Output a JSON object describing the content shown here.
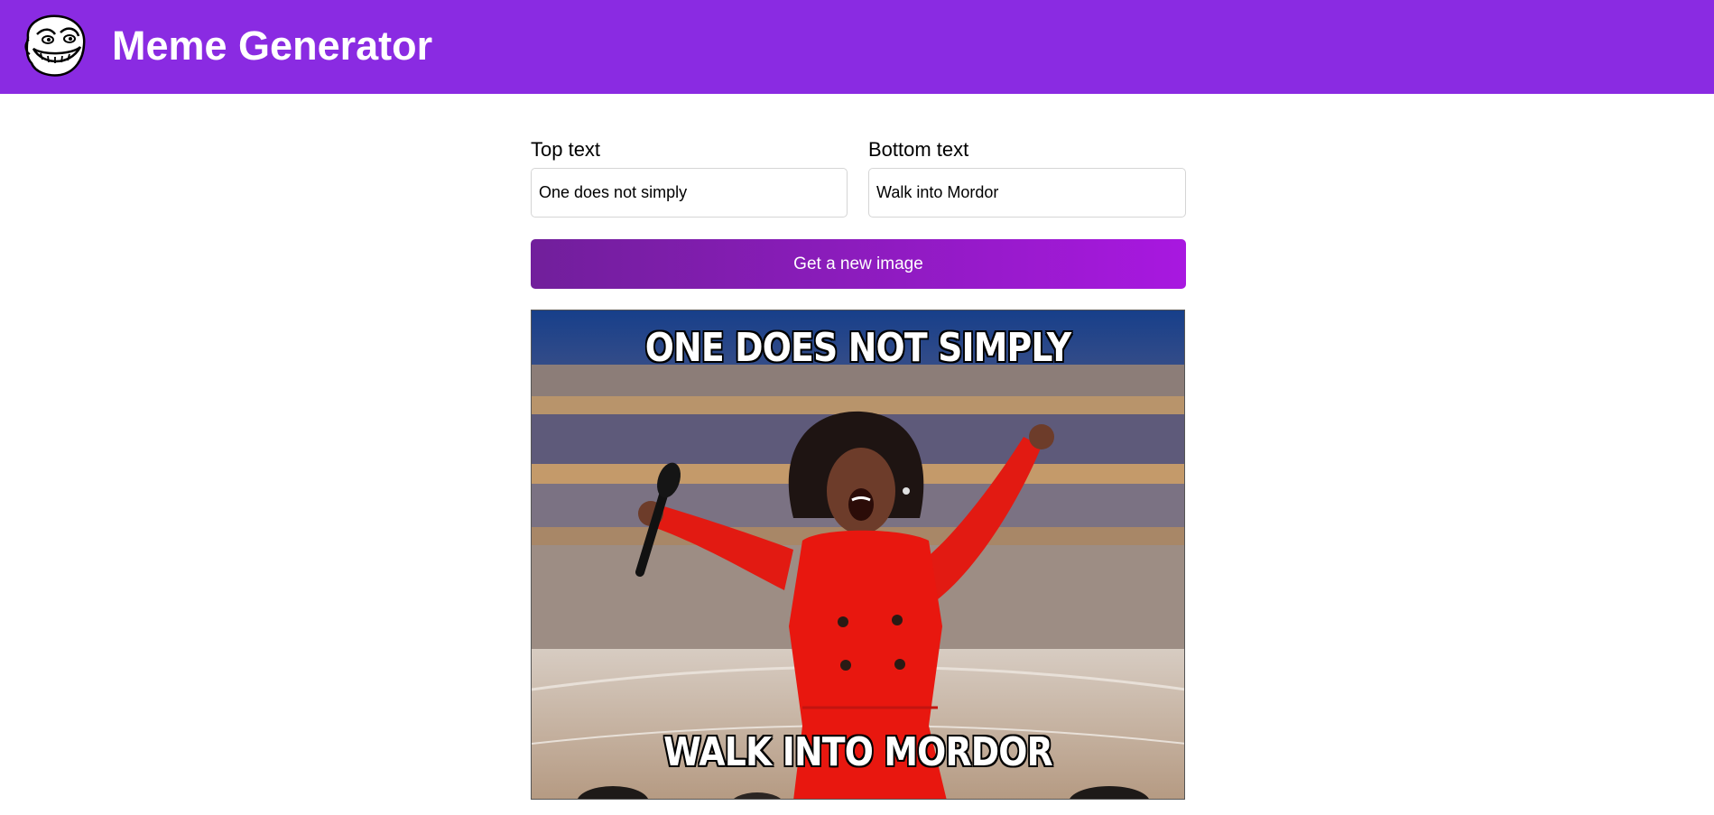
{
  "app": {
    "title": "Meme Generator",
    "logo_icon": "troll-face-icon"
  },
  "colors": {
    "header": "#8a2be2",
    "button_start": "#711f9b",
    "button_end": "#a818e0"
  },
  "form": {
    "top_label": "Top text",
    "top_value": "One does not simply",
    "bottom_label": "Bottom text",
    "bottom_value": "Walk into Mordor",
    "button_label": "Get a new image"
  },
  "meme": {
    "top_caption": "ONE DOES NOT SIMPLY",
    "bottom_caption": "WALK INTO MORDOR",
    "image_subject": "woman-in-red-dress-with-microphone"
  }
}
